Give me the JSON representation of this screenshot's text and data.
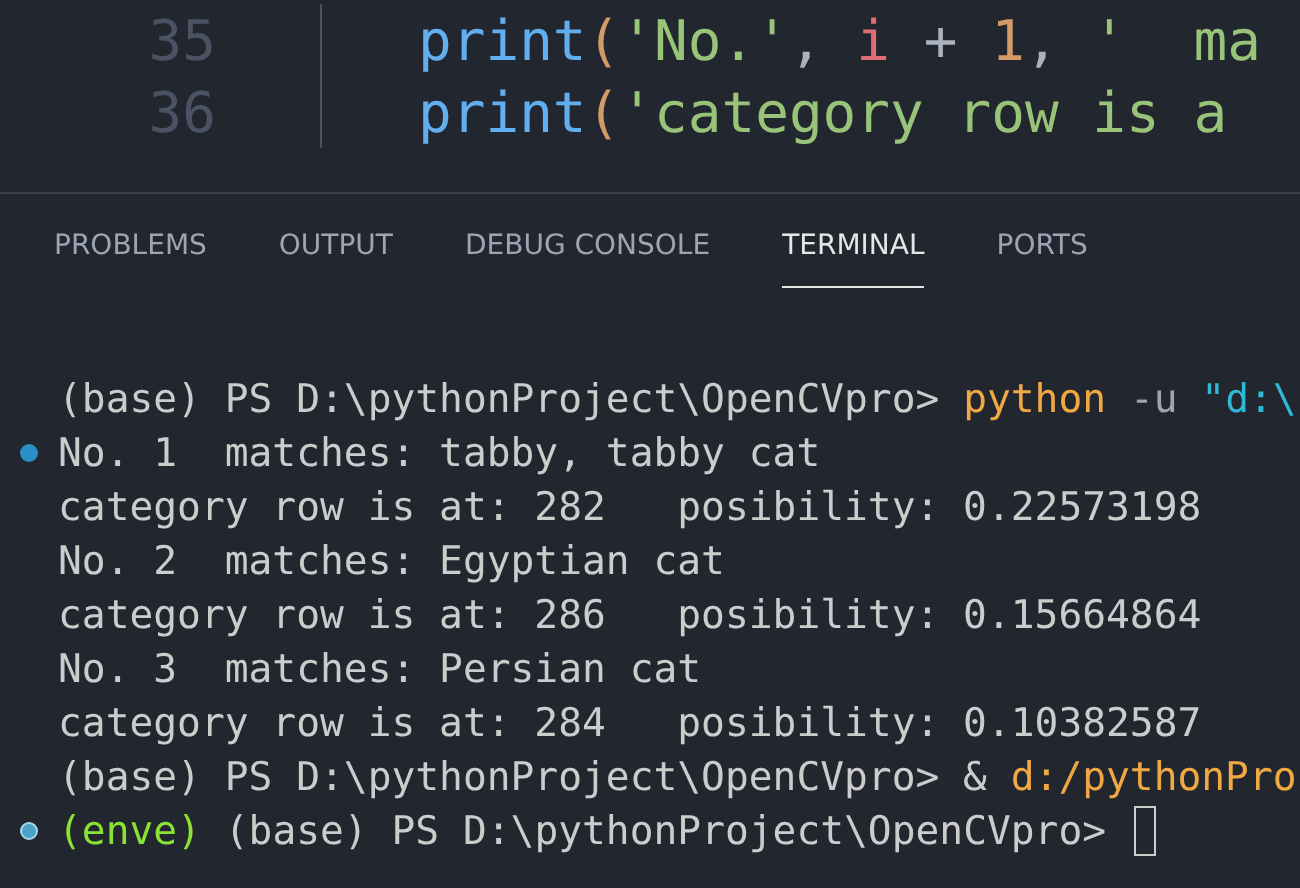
{
  "editor": {
    "lines": [
      {
        "number": "35",
        "tokens": [
          {
            "kind": "func",
            "text": "print"
          },
          {
            "kind": "paren",
            "text": "("
          },
          {
            "kind": "string",
            "text": "'No.'"
          },
          {
            "kind": "plain",
            "text": ", "
          },
          {
            "kind": "var",
            "text": "i"
          },
          {
            "kind": "plain",
            "text": " + "
          },
          {
            "kind": "number",
            "text": "1"
          },
          {
            "kind": "plain",
            "text": ", "
          },
          {
            "kind": "string",
            "text": "'  ma"
          }
        ]
      },
      {
        "number": "36",
        "tokens": [
          {
            "kind": "func",
            "text": "print"
          },
          {
            "kind": "paren",
            "text": "("
          },
          {
            "kind": "string",
            "text": "'category row is a"
          }
        ]
      }
    ]
  },
  "panel": {
    "tabs": [
      {
        "label": "PROBLEMS",
        "selected": false
      },
      {
        "label": "OUTPUT",
        "selected": false
      },
      {
        "label": "DEBUG CONSOLE",
        "selected": false
      },
      {
        "label": "TERMINAL",
        "selected": true
      },
      {
        "label": "PORTS",
        "selected": false
      }
    ]
  },
  "terminal": {
    "lines": [
      {
        "marked": false,
        "active": false,
        "segments": [
          {
            "kind": "plain",
            "text": "(base) PS D:\\pythonProject\\OpenCVpro> "
          },
          {
            "kind": "command",
            "text": "python"
          },
          {
            "kind": "flag",
            "text": " -u "
          },
          {
            "kind": "path",
            "text": "\"d:\\"
          }
        ]
      },
      {
        "marked": true,
        "active": false,
        "segments": [
          {
            "kind": "plain",
            "text": "No. 1  matches: tabby, tabby cat"
          }
        ]
      },
      {
        "marked": false,
        "active": false,
        "segments": [
          {
            "kind": "plain",
            "text": "category row is at: 282   posibility: 0.22573198"
          }
        ]
      },
      {
        "marked": false,
        "active": false,
        "segments": [
          {
            "kind": "plain",
            "text": "No. 2  matches: Egyptian cat"
          }
        ]
      },
      {
        "marked": false,
        "active": false,
        "segments": [
          {
            "kind": "plain",
            "text": "category row is at: 286   posibility: 0.15664864"
          }
        ]
      },
      {
        "marked": false,
        "active": false,
        "segments": [
          {
            "kind": "plain",
            "text": "No. 3  matches: Persian cat"
          }
        ]
      },
      {
        "marked": false,
        "active": false,
        "segments": [
          {
            "kind": "plain",
            "text": "category row is at: 284   posibility: 0.10382587"
          }
        ]
      },
      {
        "marked": false,
        "active": false,
        "segments": [
          {
            "kind": "plain",
            "text": "(base) PS D:\\pythonProject\\OpenCVpro> & "
          },
          {
            "kind": "command",
            "text": "d:/pythonPro"
          }
        ]
      },
      {
        "marked": true,
        "active": true,
        "segments": [
          {
            "kind": "env",
            "text": "(enve)"
          },
          {
            "kind": "plain",
            "text": " (base) PS D:\\pythonProject\\OpenCVpro> "
          }
        ],
        "cursor": true
      }
    ]
  }
}
